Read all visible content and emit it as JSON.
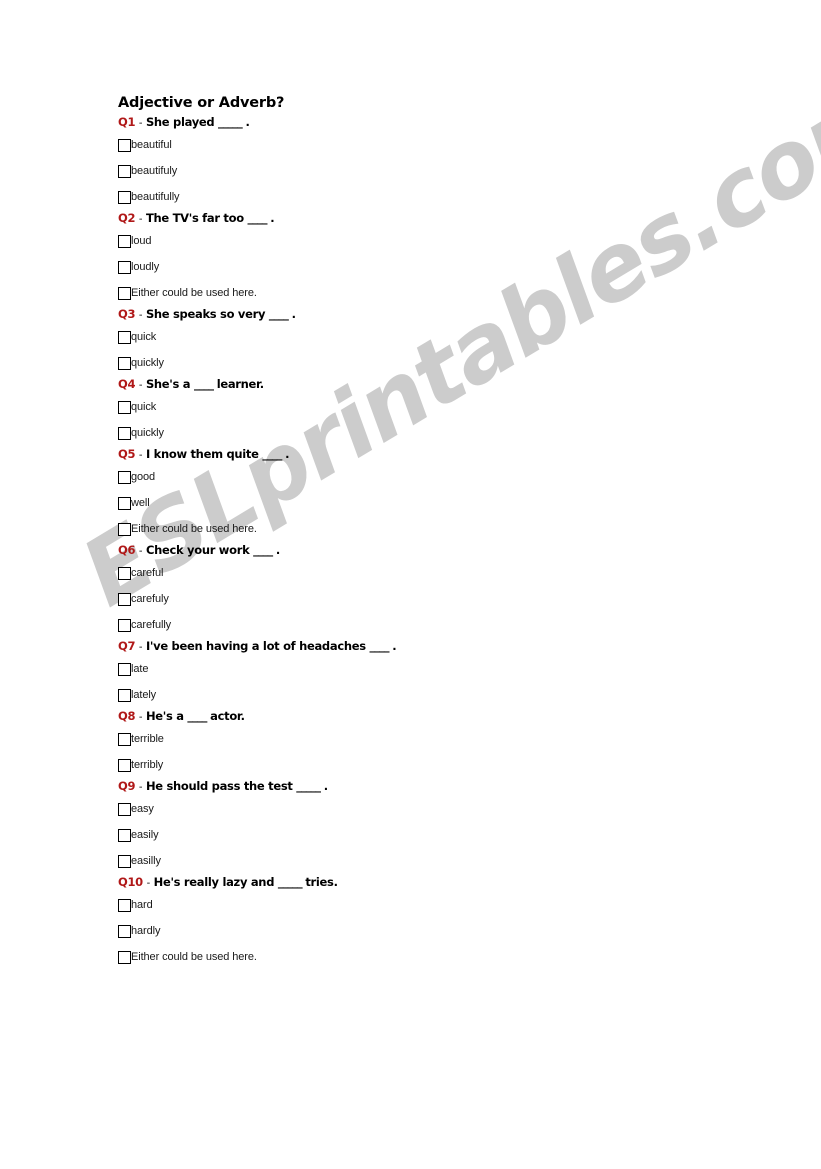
{
  "watermark": {
    "text": "ESLprintables.com",
    "color": "#cccccc"
  },
  "worksheet": {
    "title": "Adjective or Adverb?",
    "accent_color": "#b01818",
    "checkbox_glyph": "empty-checkbox",
    "questions": [
      {
        "number": "Q1",
        "separator": "-",
        "text_before": "She played",
        "blank": "_____",
        "text_after": ".",
        "options": [
          "beautiful",
          "beautifuly",
          "beautifully"
        ]
      },
      {
        "number": "Q2",
        "separator": "-",
        "text_before": "The TV's far too",
        "blank": "____",
        "text_after": ".",
        "options": [
          "loud",
          "loudly",
          "Either could be used here."
        ]
      },
      {
        "number": "Q3",
        "separator": "-",
        "text_before": "She speaks so very",
        "blank": "____",
        "text_after": ".",
        "options": [
          "quick",
          "quickly"
        ]
      },
      {
        "number": "Q4",
        "separator": "-",
        "text_before": "She's a",
        "blank": "____",
        "text_after": "learner.",
        "options": [
          "quick",
          "quickly"
        ]
      },
      {
        "number": "Q5",
        "separator": "-",
        "text_before": "I know them quite",
        "blank": "____",
        "text_after": ".",
        "options": [
          "good",
          "well",
          "Either could be used here."
        ]
      },
      {
        "number": "Q6",
        "separator": "-",
        "text_before": "Check your work",
        "blank": "____",
        "text_after": ".",
        "options": [
          "careful",
          "carefuly",
          "carefully"
        ]
      },
      {
        "number": "Q7",
        "separator": "-",
        "text_before": "I've been having a lot of headaches",
        "blank": "____",
        "text_after": ".",
        "options": [
          "late",
          "lately"
        ]
      },
      {
        "number": "Q8",
        "separator": "-",
        "text_before": "He's a",
        "blank": "____",
        "text_after": "actor.",
        "options": [
          "terrible",
          "terribly"
        ]
      },
      {
        "number": "Q9",
        "separator": "-",
        "text_before": "He should pass the test",
        "blank": "_____",
        "text_after": ".",
        "options": [
          "easy",
          "easily",
          "easilly"
        ]
      },
      {
        "number": "Q10",
        "separator": "-",
        "text_before": "He's really lazy and",
        "blank": "_____",
        "text_after": "tries.",
        "options": [
          "hard",
          "hardly",
          "Either could be used here."
        ]
      }
    ]
  }
}
